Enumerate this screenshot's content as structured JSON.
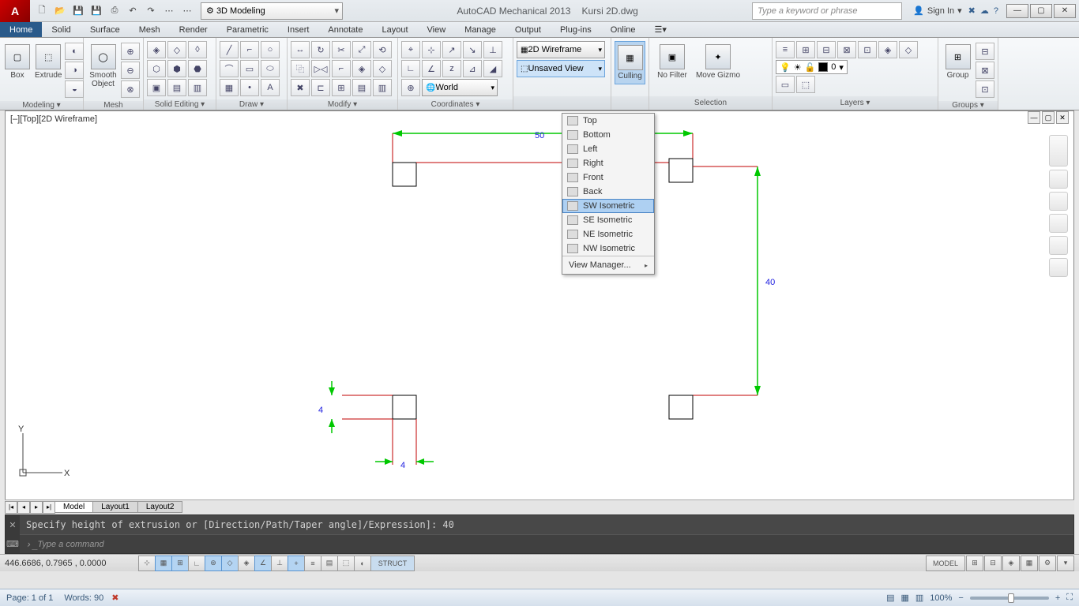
{
  "app": {
    "name": "AutoCAD Mechanical 2013",
    "file": "Kursi 2D.dwg",
    "workspace": "3D Modeling",
    "search_ph": "Type a keyword or phrase",
    "signin": "Sign In"
  },
  "menu": {
    "tabs": [
      "Home",
      "Solid",
      "Surface",
      "Mesh",
      "Render",
      "Parametric",
      "Insert",
      "Annotate",
      "Layout",
      "View",
      "Manage",
      "Output",
      "Plug-ins",
      "Online"
    ]
  },
  "ribbon": {
    "modeling": {
      "label": "Modeling ▾",
      "box": "Box",
      "extrude": "Extrude"
    },
    "mesh": {
      "label": "Mesh",
      "smooth": "Smooth Object"
    },
    "solidedit": {
      "label": "Solid Editing ▾"
    },
    "draw": {
      "label": "Draw ▾"
    },
    "modify": {
      "label": "Modify ▾"
    },
    "coordinates": {
      "label": "Coordinates ▾",
      "world": "World"
    },
    "view": {
      "visual": "2D Wireframe",
      "unsaved": "Unsaved View"
    },
    "culling": {
      "label": "Culling"
    },
    "selection": {
      "label": "Selection",
      "nofilter": "No Filter",
      "gizmo": "Move Gizmo"
    },
    "layers": {
      "label": "Layers ▾",
      "current": "0"
    },
    "groups": {
      "label": "Groups ▾",
      "group": "Group"
    }
  },
  "viewport": {
    "label": "[–][Top][2D Wireframe]"
  },
  "viewmenu": {
    "items": [
      "Top",
      "Bottom",
      "Left",
      "Right",
      "Front",
      "Back",
      "SW Isometric",
      "SE Isometric",
      "NE Isometric",
      "NW Isometric"
    ],
    "selected": "SW Isometric",
    "footer": "View Manager..."
  },
  "dims": {
    "w": "50",
    "h": "40",
    "sq1": "4",
    "sq2": "4"
  },
  "tabs": {
    "model": "Model",
    "l1": "Layout1",
    "l2": "Layout2"
  },
  "cmd": {
    "history": "Specify height of extrusion or [Direction/Path/Taper angle]/Expression]: 40",
    "prompt": "Type a command"
  },
  "status": {
    "coords": "446.6686, 0.7965 , 0.0000",
    "struct": "STRUCT",
    "model": "MODEL"
  },
  "word": {
    "page": "Page: 1 of 1",
    "words": "Words: 90",
    "zoom": "100%"
  }
}
